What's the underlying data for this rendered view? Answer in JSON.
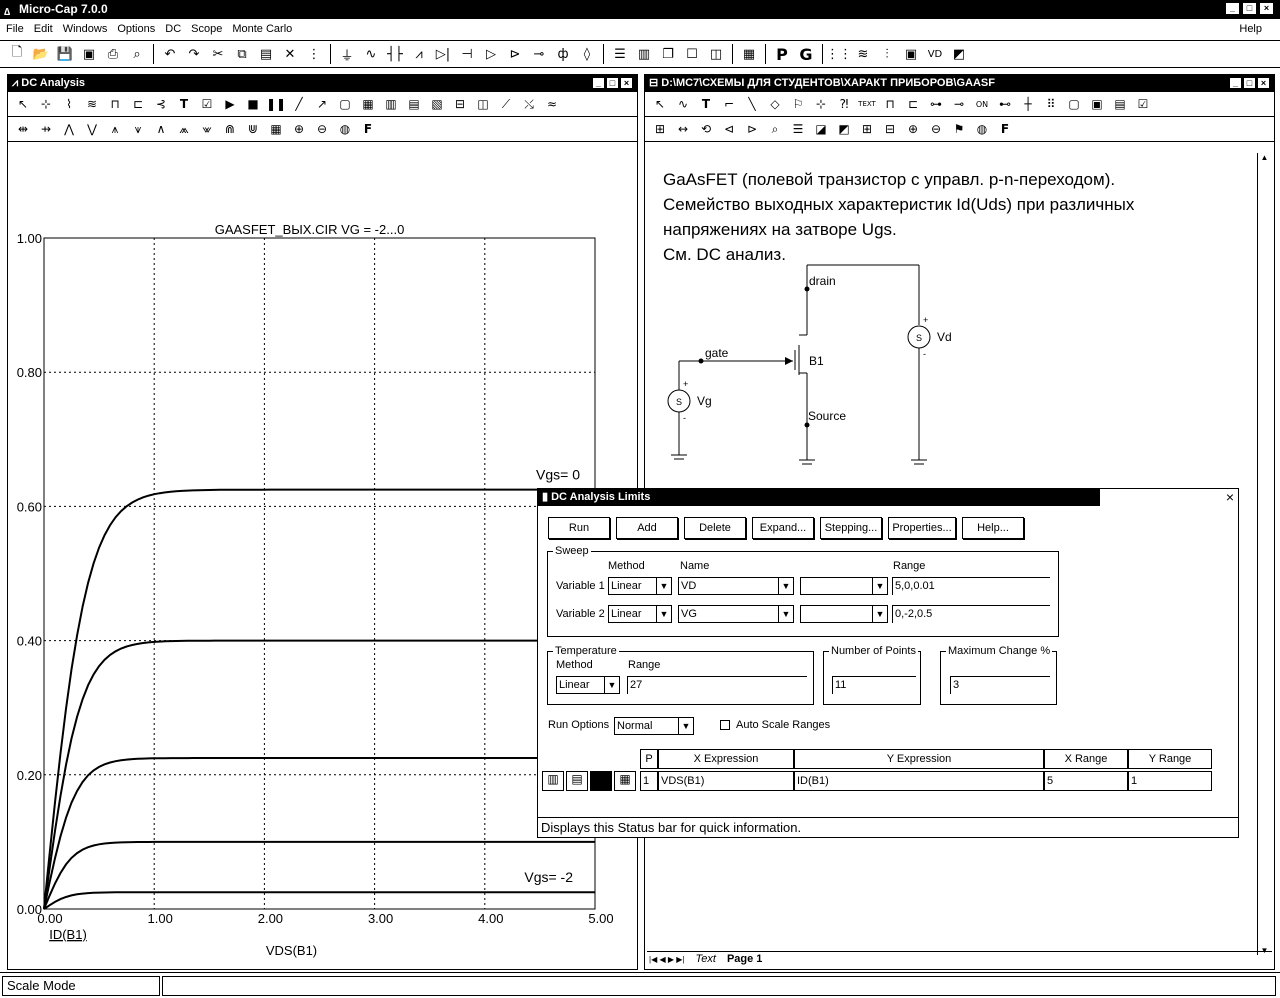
{
  "app": {
    "title": "Micro-Cap 7.0.0",
    "help_label": "Help"
  },
  "menu": [
    "File",
    "Edit",
    "Windows",
    "Options",
    "DC",
    "Scope",
    "Monte Carlo"
  ],
  "toolbar_icons": [
    "new-icon",
    "open-icon",
    "save-icon",
    "save-all-icon",
    "print-icon",
    "print-preview-icon",
    "undo-icon",
    "redo-icon",
    "cut-icon",
    "copy-icon",
    "paste-icon",
    "delete-icon",
    "select-all-icon",
    "ground-icon",
    "wire-icon",
    "capacitor-icon",
    "resistor-icon",
    "diode-icon",
    "transistor-icon",
    "opamp-icon",
    "buffer-icon",
    "gate-icon",
    "source-icon",
    "meter-icon",
    "tile-horizontal-icon",
    "tile-vertical-icon",
    "cascade-icon",
    "window-icon",
    "split-icon",
    "calculator-icon",
    "probe-p-icon",
    "probe-g-icon",
    "components-icon",
    "waveform-icon",
    "stepping-icon",
    "frame-icon",
    "vd-icon",
    "plot-icon"
  ],
  "dc_window": {
    "title": "DC Analysis",
    "plot_title": "GAASFET_ВЫХ.CIR VG = -2...0",
    "x_axis_label": "VDS(B1)",
    "y_axis_label": "ID(B1)",
    "annotations": [
      "Vgs= 0",
      "Vgs= -2"
    ]
  },
  "chart_data": {
    "type": "line",
    "title": "GAASFET_ВЫХ.CIR VG = -2...0",
    "xlabel": "VDS(B1)",
    "ylabel": "ID(B1)",
    "xlim": [
      0,
      5
    ],
    "ylim": [
      0,
      1
    ],
    "x_ticks": [
      "0.00",
      "1.00",
      "2.00",
      "3.00",
      "4.00",
      "5.00"
    ],
    "y_ticks": [
      "0.00",
      "0.20",
      "0.40",
      "0.60",
      "0.80",
      "1.00"
    ],
    "grid": true,
    "series": [
      {
        "name": "Vgs= 0",
        "sat": 0.625,
        "k": 2.6
      },
      {
        "name": "",
        "sat": 0.4,
        "k": 3.0
      },
      {
        "name": "",
        "sat": 0.225,
        "k": 3.5
      },
      {
        "name": "",
        "sat": 0.1,
        "k": 4.0
      },
      {
        "name": "Vgs= -2",
        "sat": 0.025,
        "k": 4.5
      }
    ]
  },
  "schematic_window": {
    "title": "D:\\MC7\\СХЕМЫ ДЛЯ СТУДЕНТОВ\\ХАРАКТ ПРИБОРОВ\\GAASF",
    "text_lines": [
      "GaAsFET (полевой транзистор с управл. p-n-переходом).",
      "Семейство выходных характеристик Id(Uds) при различных",
      "напряжениях на затворе Ugs.",
      "См. DC анализ."
    ],
    "labels": {
      "drain": "drain",
      "gate": "gate",
      "source": "Source",
      "b1": "B1",
      "vd": "Vd",
      "vg": "Vg",
      "s": "S"
    },
    "tabs": {
      "text": "Text",
      "page": "Page 1"
    }
  },
  "dialog": {
    "title": "DC Analysis Limits",
    "buttons": [
      "Run",
      "Add",
      "Delete",
      "Expand...",
      "Stepping...",
      "Properties...",
      "Help..."
    ],
    "sweep": {
      "label": "Sweep",
      "col_method": "Method",
      "col_name": "Name",
      "col_range": "Range",
      "var1": {
        "label": "Variable 1",
        "method": "Linear",
        "name": "VD",
        "extra": "",
        "range": "5,0,0.01"
      },
      "var2": {
        "label": "Variable 2",
        "method": "Linear",
        "name": "VG",
        "extra": "",
        "range": "0,-2,0.5"
      }
    },
    "temperature": {
      "label": "Temperature",
      "method_label": "Method",
      "range_label": "Range",
      "method": "Linear",
      "range": "27"
    },
    "points": {
      "label": "Number of Points",
      "value": "11"
    },
    "maxchange": {
      "label": "Maximum Change %",
      "value": "3"
    },
    "run_options": {
      "label": "Run Options",
      "value": "Normal"
    },
    "autoscale": {
      "label": "Auto Scale Ranges"
    },
    "table": {
      "headers": [
        "P",
        "X Expression",
        "Y Expression",
        "X Range",
        "Y Range"
      ],
      "rows": [
        {
          "p": "1",
          "x": "VDS(B1)",
          "y": "ID(B1)",
          "xr": "5",
          "yr": "1"
        }
      ]
    },
    "status": "Displays this Status bar for quick information."
  },
  "statusbar": {
    "mode": "Scale Mode"
  }
}
